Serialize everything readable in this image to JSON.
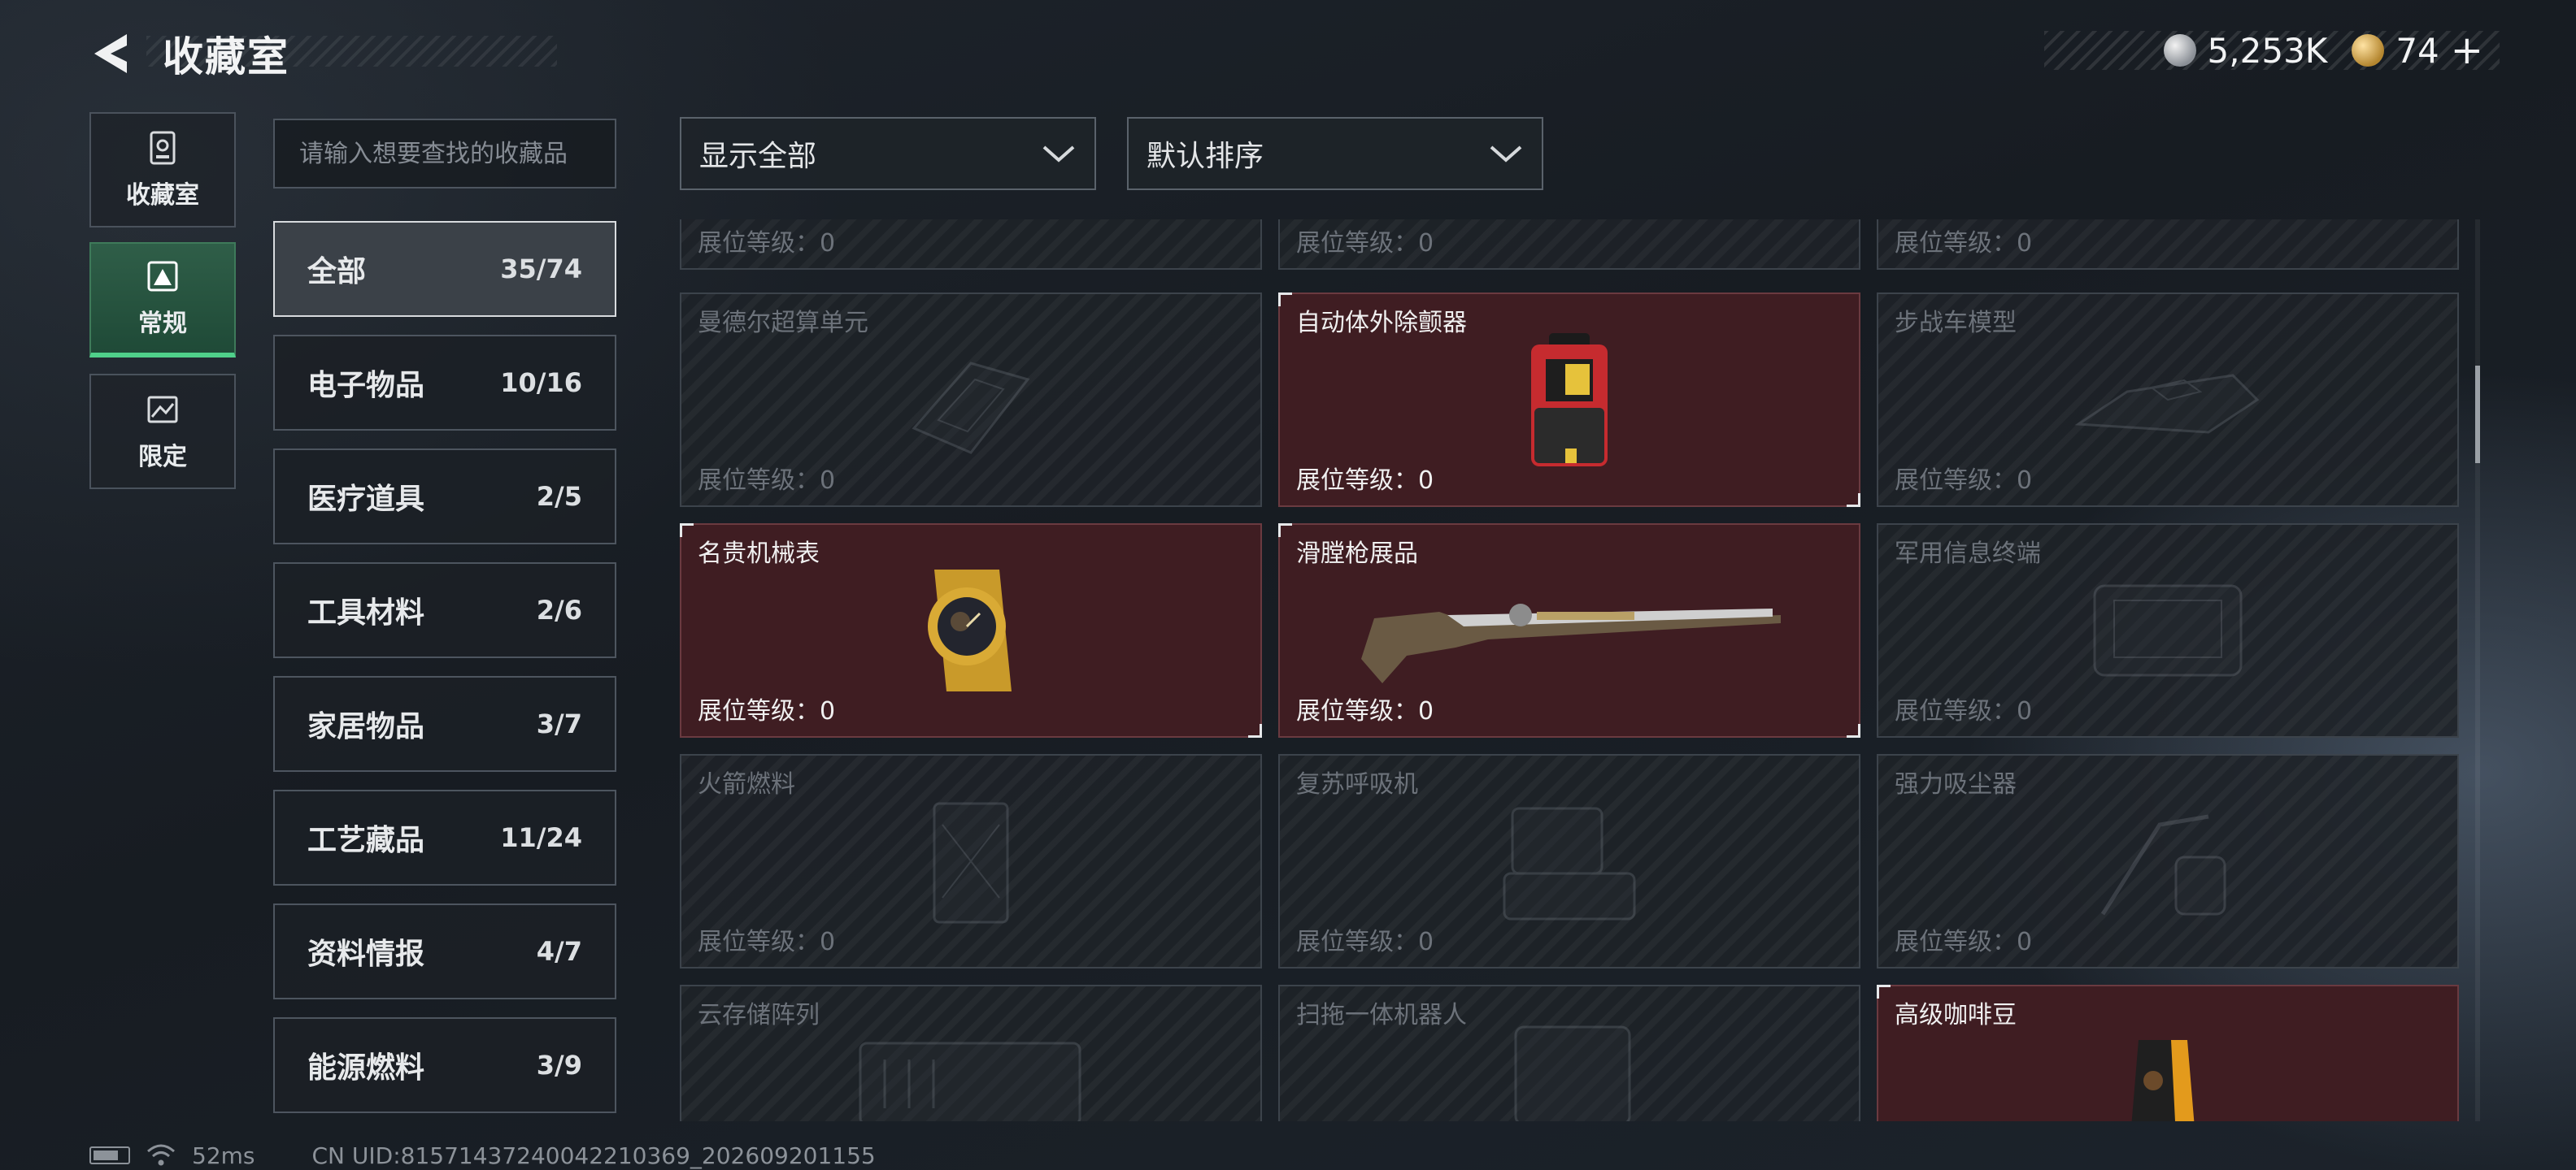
{
  "header": {
    "title": "收藏室",
    "silver_value": "5,253K",
    "gold_value": "74",
    "gold_plus": "+"
  },
  "rail": [
    {
      "label": "收藏室",
      "icon": "vault-icon"
    },
    {
      "label": "常规",
      "icon": "regular-collection-icon",
      "active": true
    },
    {
      "label": "限定",
      "icon": "limited-collection-icon"
    }
  ],
  "search": {
    "placeholder": "请输入想要查找的收藏品"
  },
  "categories": [
    {
      "name": "全部",
      "count": "35/74",
      "active": true
    },
    {
      "name": "电子物品",
      "count": "10/16"
    },
    {
      "name": "医疗道具",
      "count": "2/5"
    },
    {
      "name": "工具材料",
      "count": "2/6"
    },
    {
      "name": "家居物品",
      "count": "3/7"
    },
    {
      "name": "工艺藏品",
      "count": "11/24"
    },
    {
      "name": "资料情报",
      "count": "4/7"
    },
    {
      "name": "能源燃料",
      "count": "3/9"
    }
  ],
  "filters": {
    "display": "显示全部",
    "sort": "默认排序"
  },
  "level_label": "展位等级：0",
  "cards": [
    {
      "name": "",
      "owned": false,
      "art": "none"
    },
    {
      "name": "",
      "owned": false,
      "art": "none"
    },
    {
      "name": "",
      "owned": false,
      "art": "none"
    },
    {
      "name": "曼德尔超算单元",
      "owned": false,
      "art": "supercomputer"
    },
    {
      "name": "自动体外除颤器",
      "owned": true,
      "art": "defibrillator"
    },
    {
      "name": "步战车模型",
      "owned": false,
      "art": "ifv-model"
    },
    {
      "name": "名贵机械表",
      "owned": true,
      "art": "watch"
    },
    {
      "name": "滑膛枪展品",
      "owned": true,
      "art": "musket"
    },
    {
      "name": "军用信息终端",
      "owned": false,
      "art": "terminal"
    },
    {
      "name": "火箭燃料",
      "owned": false,
      "art": "rocket-fuel"
    },
    {
      "name": "复苏呼吸机",
      "owned": false,
      "art": "ventilator"
    },
    {
      "name": "强力吸尘器",
      "owned": false,
      "art": "vacuum"
    },
    {
      "name": "云存储阵列",
      "owned": false,
      "art": "storage-array"
    },
    {
      "name": "扫拖一体机器人",
      "owned": false,
      "art": "robot-mop"
    },
    {
      "name": "高级咖啡豆",
      "owned": true,
      "art": "coffee-beans"
    }
  ],
  "footer": {
    "ping": "52ms",
    "uid": "CN UID:81571437240042210369_202609201155"
  },
  "colors": {
    "owned_card": "#3f1d22",
    "active_rail": "#2f5e48",
    "active_rail_accent": "#4fd08a"
  }
}
